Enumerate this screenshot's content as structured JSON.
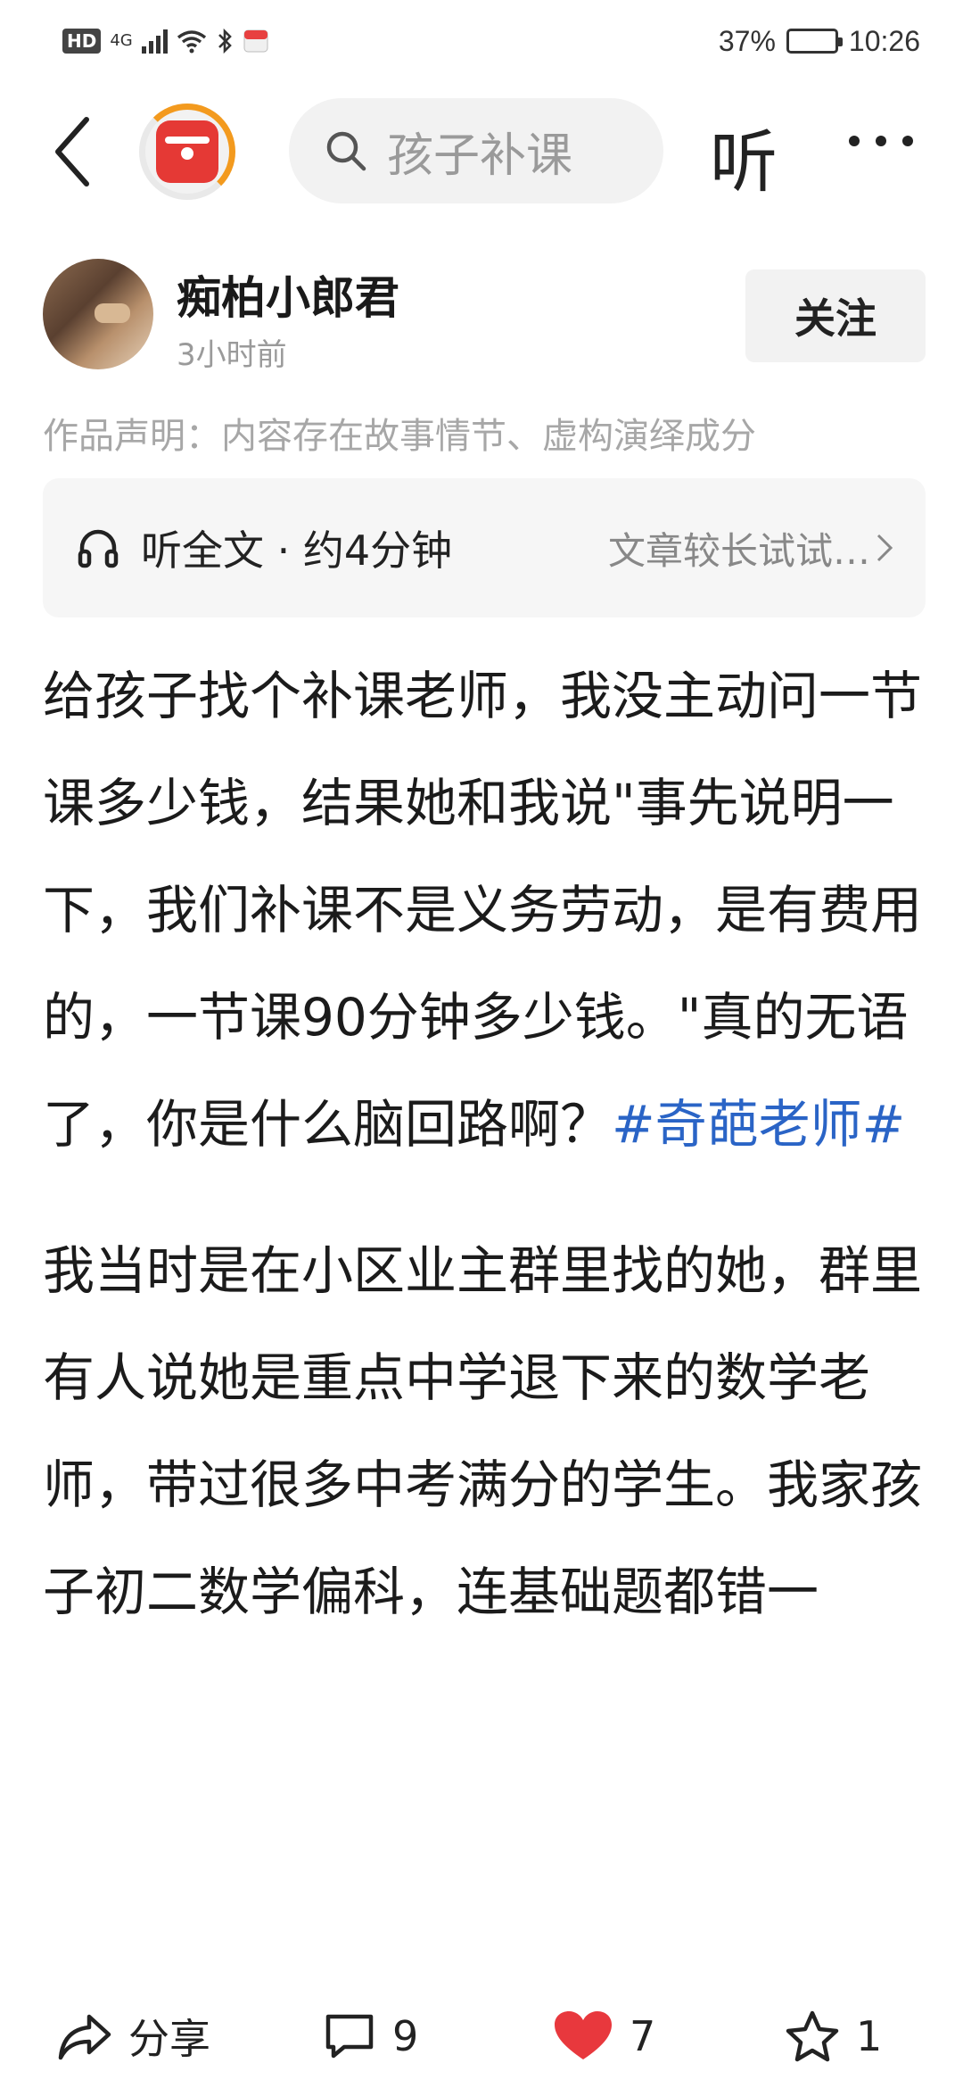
{
  "status_bar": {
    "network": "HD",
    "signal_type": "4G",
    "battery_percent": "37%",
    "battery_level": 0.37,
    "time": "10:26"
  },
  "nav": {
    "back_icon": "back-arrow-icon",
    "channel_icon": "red-envelope-icon",
    "search_placeholder": "孩子补课",
    "listen_label": "听",
    "more_icon": "more-dots-icon"
  },
  "author": {
    "name": "痴柏小郎君",
    "time": "3小时前",
    "follow_label": "关注"
  },
  "declaration": "作品声明：内容存在故事情节、虚构演绎成分",
  "audio": {
    "label": "听全文 · 约4分钟",
    "hint": "文章较长试试…"
  },
  "article": {
    "para1_text": "给孩子找个补课老师，我没主动问一节课多少钱，结果她和我说\"事先说明一下，我们补课不是义务劳动，是有费用的，一节课90分钟多少钱。\"真的无语了，你是什么脑回路啊？",
    "para1_tag": "#奇葩老师#",
    "para2_text": "我当时是在小区业主群里找的她，群里有人说她是重点中学退下来的数学老师，带过很多中考满分的学生。我家孩子初二数学偏科，连基础题都错一"
  },
  "bottom_bar": {
    "share_label": "分享",
    "comment_count": "9",
    "like_count": "7",
    "favorite_count": "1",
    "like_color": "#e8383d"
  }
}
